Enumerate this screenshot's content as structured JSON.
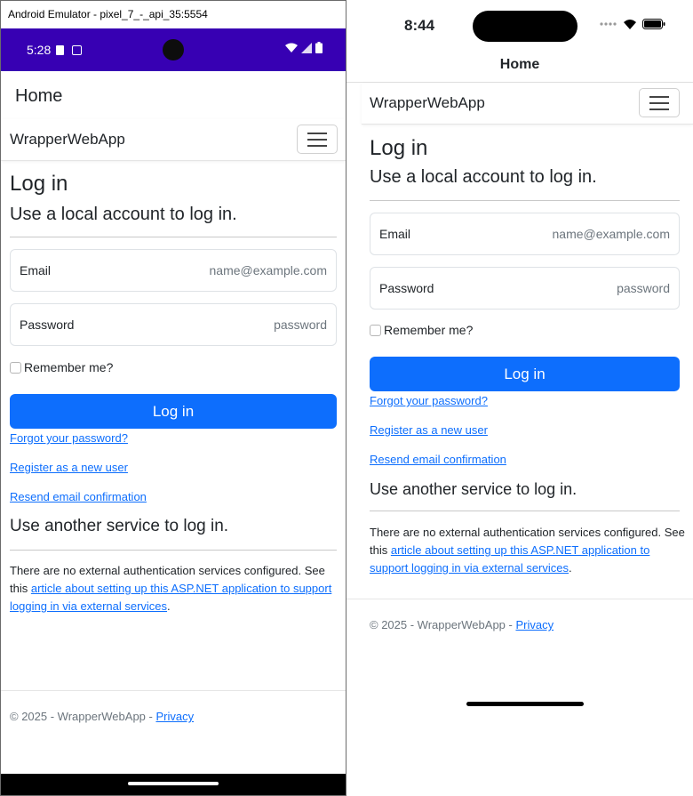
{
  "android": {
    "window_title": "Android Emulator - pixel_7_-_api_35:5554",
    "status_time": "5:28",
    "app_bar_title": "Home",
    "brand": "WrapperWebApp",
    "heading": "Log in",
    "subheading": "Use a local account to log in.",
    "email_label": "Email",
    "email_placeholder": "name@example.com",
    "password_label": "Password",
    "password_placeholder": "password",
    "remember_label": "Remember me?",
    "login_button": "Log in",
    "forgot_link": "Forgot your password?",
    "register_link": "Register as a new user",
    "resend_link": "Resend email confirmation",
    "external_heading": "Use another service to log in.",
    "external_text_1": "There are no external authentication services configured. See this",
    "external_link": "article about setting up this ASP.NET application to support logging in via external services",
    "external_text_end": ".",
    "footer_text": "© 2025 - WrapperWebApp -",
    "footer_link": "Privacy"
  },
  "ios": {
    "status_time": "8:44",
    "nav_title": "Home",
    "brand": "WrapperWebApp",
    "heading": "Log in",
    "subheading": "Use a local account to log in.",
    "email_label": "Email",
    "email_placeholder": "name@example.com",
    "password_label": "Password",
    "password_placeholder": "password",
    "remember_label": "Remember me?",
    "login_button": "Log in",
    "forgot_link": "Forgot your password?",
    "register_link": "Register as a new user",
    "resend_link": "Resend email confirmation",
    "external_heading": "Use another service to log in.",
    "external_text_1": "There are no external authentication services configured. See this",
    "external_link": "article about setting up this ASP.NET application to support logging in via external services",
    "external_text_end": ".",
    "footer_text": "© 2025 - WrapperWebApp -",
    "footer_link": "Privacy"
  },
  "colors": {
    "android_status_bar": "#3700b3",
    "primary_button": "#0d6efd",
    "link": "#0d6efd"
  }
}
